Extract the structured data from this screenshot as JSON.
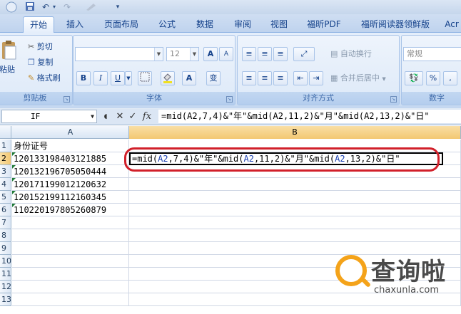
{
  "qat": {
    "save_icon": "save-icon",
    "undo_glyph": "↶",
    "redo_glyph": "↷",
    "customize_glyph": "▾"
  },
  "tabs": [
    {
      "label": "开始",
      "active": true
    },
    {
      "label": "插入"
    },
    {
      "label": "页面布局"
    },
    {
      "label": "公式"
    },
    {
      "label": "数据"
    },
    {
      "label": "审阅"
    },
    {
      "label": "视图"
    },
    {
      "label": "福昕PDF"
    },
    {
      "label": "福昕阅读器领鲜版"
    },
    {
      "label": "Acr"
    }
  ],
  "ribbon": {
    "clipboard": {
      "paste": "粘贴",
      "cut": "剪切",
      "copy": "复制",
      "format_painter": "格式刷",
      "label": "剪贴板"
    },
    "font": {
      "font_name": "",
      "font_size": "12",
      "grow": "A",
      "shrink": "A",
      "bold": "B",
      "italic": "I",
      "underline": "U",
      "phonetic": "变",
      "label": "字体"
    },
    "alignment": {
      "wrap": "自动换行",
      "merge": "合并后居中",
      "label": "对齐方式"
    },
    "number": {
      "format": "常规",
      "percent": "%",
      "comma": ",",
      "label": "数字"
    }
  },
  "formula_bar": {
    "name_box": "IF",
    "fx": "fx",
    "cancel": "✕",
    "enter": "✓",
    "formula": "=mid(A2,7,4)&\"年\"&mid(A2,11,2)&\"月\"&mid(A2,13,2)&\"日\""
  },
  "grid": {
    "columns": [
      "A",
      "B"
    ],
    "rows": [
      {
        "n": "1",
        "a": "身份证号",
        "b": ""
      },
      {
        "n": "2",
        "a": "120133198403121885",
        "b": ""
      },
      {
        "n": "3",
        "a": "120132196705050444",
        "b": ""
      },
      {
        "n": "4",
        "a": "120171199012120632",
        "b": ""
      },
      {
        "n": "5",
        "a": "120152199112160345",
        "b": ""
      },
      {
        "n": "6",
        "a": "110220197805260879",
        "b": ""
      },
      {
        "n": "7",
        "a": "",
        "b": ""
      },
      {
        "n": "8",
        "a": "",
        "b": ""
      },
      {
        "n": "9",
        "a": "",
        "b": ""
      },
      {
        "n": "10",
        "a": "",
        "b": ""
      },
      {
        "n": "11",
        "a": "",
        "b": ""
      },
      {
        "n": "12",
        "a": "",
        "b": ""
      },
      {
        "n": "13",
        "a": "",
        "b": ""
      }
    ],
    "edit_parts": {
      "p1": "=mid(",
      "r1": "A2",
      "p2": ",7,4)&\"年\"&mid(",
      "r2": "A2",
      "p3": ",11,2)&\"月\"&mid(",
      "r3": "A2",
      "p4": ",13,2)&\"日\""
    }
  },
  "watermark": {
    "text": "查询啦",
    "url": "chaxunla.com"
  },
  "colors": {
    "highlight_ring": "#d1202a",
    "cell_ref": "#1b40b0",
    "watermark_orange": "#f4a31a"
  }
}
